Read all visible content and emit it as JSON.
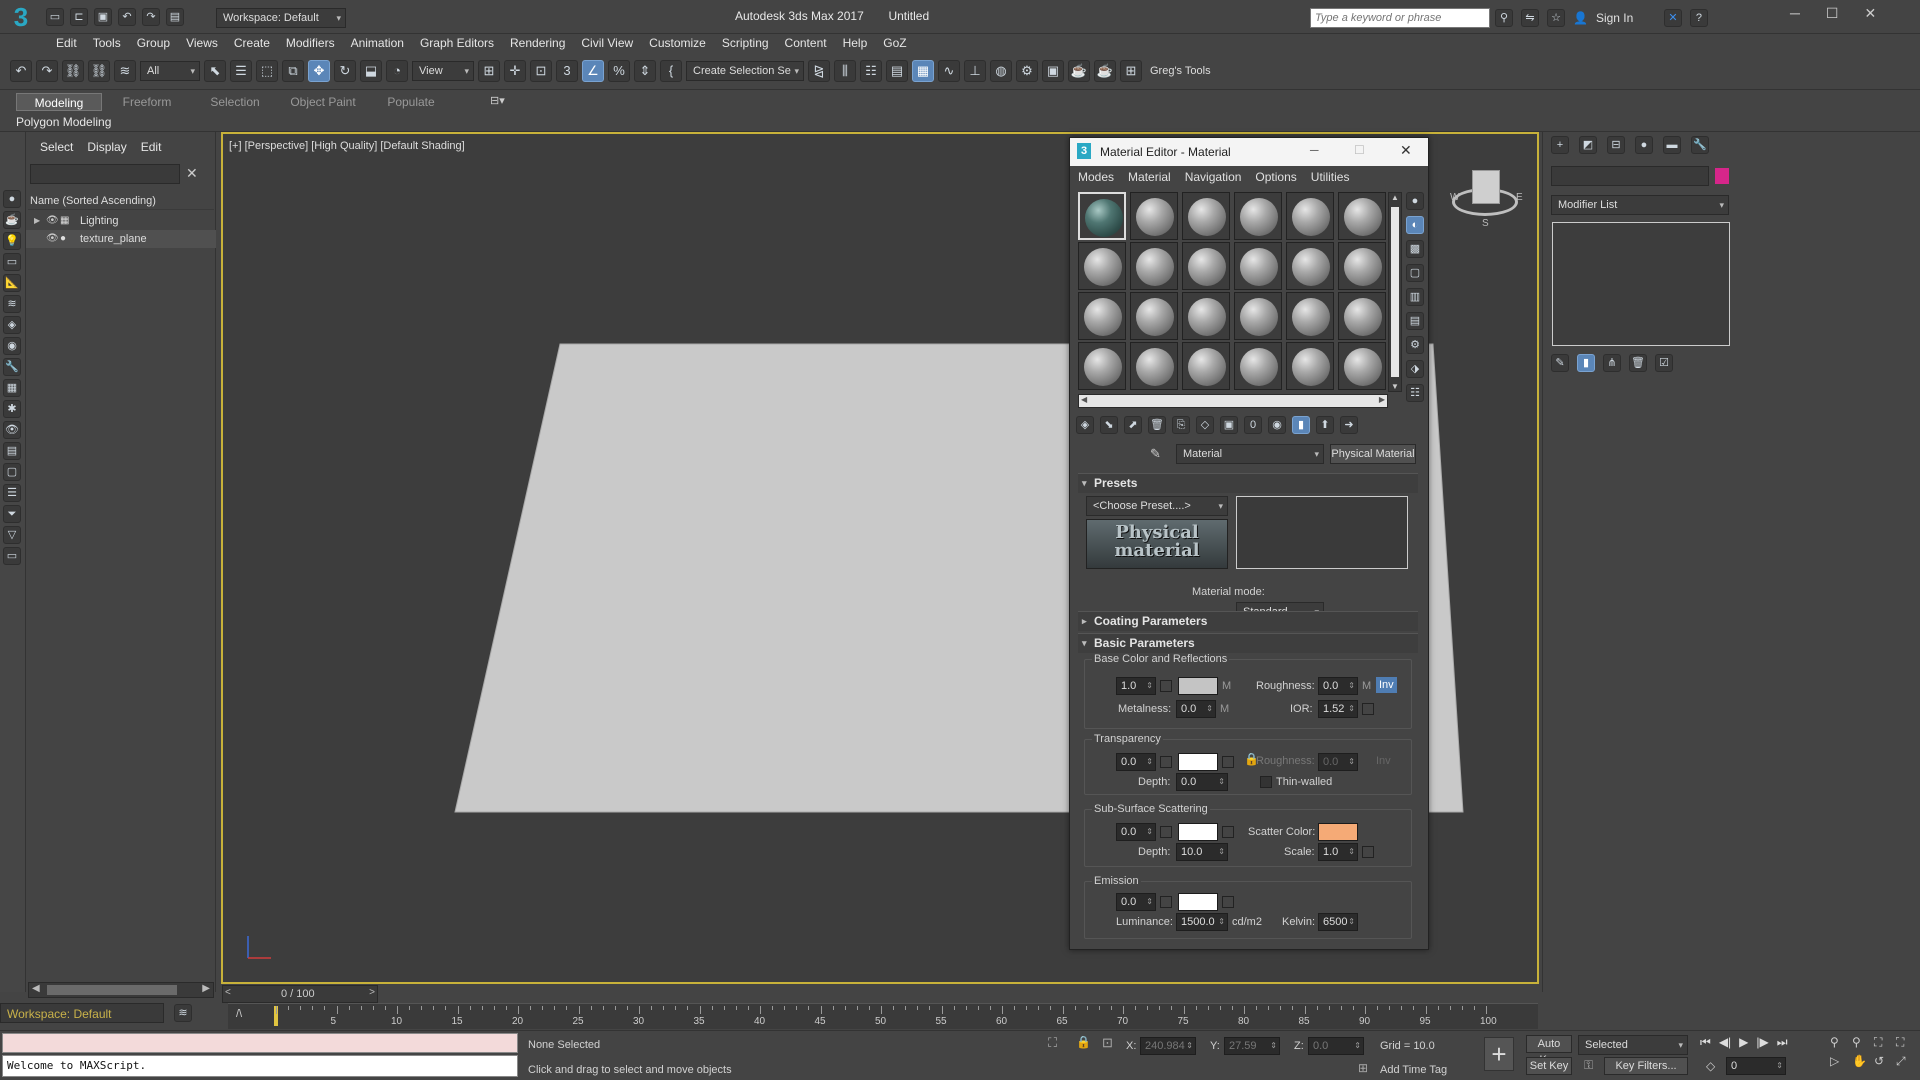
{
  "app": {
    "title": "Autodesk 3ds Max 2017",
    "doc": "Untitled",
    "logo": "3",
    "workspace": "Workspace: Default",
    "search_placeholder": "Type a keyword or phrase",
    "sign_in": "Sign In"
  },
  "menu": [
    "Edit",
    "Tools",
    "Group",
    "Views",
    "Create",
    "Modifiers",
    "Animation",
    "Graph Editors",
    "Rendering",
    "Civil View",
    "Customize",
    "Scripting",
    "Content",
    "Help",
    "GoZ"
  ],
  "toolbar": {
    "filter": "All",
    "ref_coord": "View",
    "selection_set": "Create Selection Se",
    "gregs_tools": "Greg's Tools"
  },
  "ribbon": {
    "tabs": [
      "Modeling",
      "Freeform",
      "Selection",
      "Object Paint",
      "Populate"
    ],
    "active_tab": "Modeling",
    "panel": "Polygon Modeling"
  },
  "scene_explorer": {
    "tabs": [
      "Select",
      "Display",
      "Edit"
    ],
    "column": "Name (Sorted Ascending)",
    "items": [
      {
        "name": "Lighting",
        "expand": "▶"
      },
      {
        "name": "texture_plane",
        "expand": ""
      }
    ]
  },
  "viewport": {
    "label": "[+] [Perspective] [High Quality] [Default Shading]",
    "nav_labels": {
      "west": "W",
      "east": "E",
      "south": "S"
    }
  },
  "material_editor": {
    "title": "Material Editor - Material",
    "menu": [
      "Modes",
      "Material",
      "Navigation",
      "Options",
      "Utilities"
    ],
    "material_name": "Material",
    "material_type": "Physical Material",
    "presets": {
      "title": "Presets",
      "choose": "<Choose Preset....>",
      "logo_text": "Physical material"
    },
    "material_mode_label": "Material mode:",
    "material_mode_value": "Standard",
    "coating_title": "Coating Parameters",
    "basic_title": "Basic Parameters",
    "base": {
      "title": "Base Color and Reflections",
      "weight": "1.0",
      "roughness_label": "Roughness:",
      "roughness": "0.0",
      "m": "M",
      "inv": "Inv",
      "metalness_label": "Metalness:",
      "metalness": "0.0",
      "ior_label": "IOR:",
      "ior": "1.52",
      "color": "#c4c4c4"
    },
    "transparency": {
      "title": "Transparency",
      "weight": "0.0",
      "roughness_label": "Roughness:",
      "roughness": "0.0",
      "inv": "Inv",
      "depth_label": "Depth:",
      "depth": "0.0",
      "thin_walled": "Thin-walled",
      "color": "#ffffff"
    },
    "sss": {
      "title": "Sub-Surface Scattering",
      "weight": "0.0",
      "scatter_label": "Scatter Color:",
      "scatter_color": "#f5aa76",
      "depth_label": "Depth:",
      "depth": "10.0",
      "scale_label": "Scale:",
      "scale": "1.0",
      "color": "#ffffff"
    },
    "emission": {
      "title": "Emission",
      "weight": "0.0",
      "luminance_label": "Luminance:",
      "luminance": "1500.0",
      "unit": "cd/m2",
      "kelvin_label": "Kelvin:",
      "kelvin": "6500",
      "color": "#ffffff"
    }
  },
  "command_panel": {
    "modifier_list": "Modifier List",
    "color_swatch": "#d6268a"
  },
  "timeline": {
    "frame": "0 / 100",
    "ticks": [
      "5",
      "10",
      "15",
      "20",
      "25",
      "30",
      "35",
      "40",
      "45",
      "50",
      "55",
      "60",
      "65",
      "70",
      "75",
      "80",
      "85",
      "90",
      "95",
      "100"
    ]
  },
  "status": {
    "workspace": "Workspace: Default",
    "maxscript": "Welcome to MAXScript.",
    "selection": "None Selected",
    "prompt": "Click and drag to select and move objects",
    "x_label": "X:",
    "x": "240.984",
    "y_label": "Y:",
    "y": "27.59",
    "z_label": "Z:",
    "z": "0.0",
    "grid": "Grid = 10.0",
    "add_time_tag": "Add Time Tag",
    "auto_key": "Auto Key",
    "set_key": "Set Key",
    "selected": "Selected",
    "key_filters": "Key Filters...",
    "current_frame": "0"
  }
}
